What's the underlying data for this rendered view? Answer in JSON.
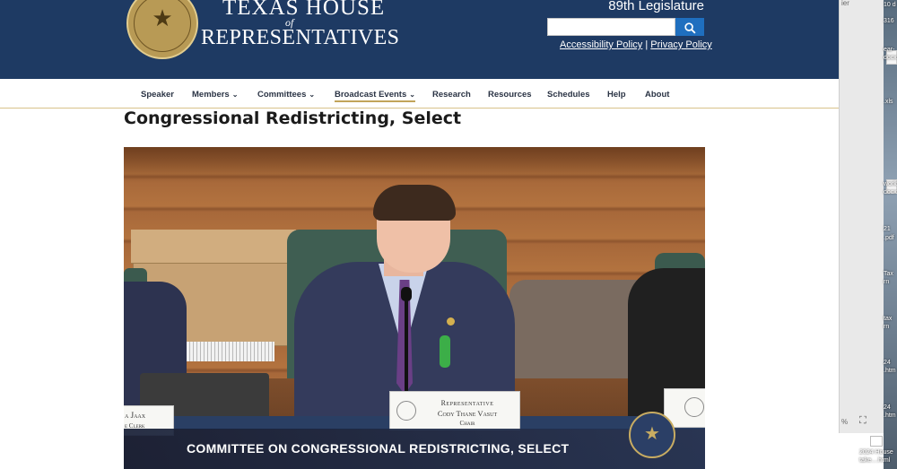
{
  "header": {
    "title_line1": "TEXAS HOUSE",
    "title_of": "of",
    "title_line2": "REPRESENTATIVES",
    "legislature": "89th Legislature",
    "search": {
      "placeholder": "",
      "value": ""
    },
    "accessibility_link": "Accessibility Policy",
    "separator": "|",
    "privacy_link": "Privacy Policy"
  },
  "nav": {
    "items": [
      {
        "label": "Speaker",
        "chevron": ""
      },
      {
        "label": "Members",
        "chevron": "⌄"
      },
      {
        "label": "Committees",
        "chevron": "⌄"
      },
      {
        "label": "Broadcast Events",
        "chevron": "⌄"
      },
      {
        "label": "Research",
        "chevron": ""
      },
      {
        "label": "Resources",
        "chevron": ""
      },
      {
        "label": "Schedules",
        "chevron": ""
      },
      {
        "label": "Help",
        "chevron": ""
      },
      {
        "label": "About",
        "chevron": ""
      }
    ],
    "active_item": "Broadcast Events"
  },
  "page": {
    "title": "Congressional Redistricting, Select"
  },
  "video": {
    "caption": "COMMITTEE ON CONGRESSIONAL REDISTRICTING, SELECT",
    "placard_chair": {
      "line1": "Representative",
      "line2": "Cody Thane Vasut",
      "line3": "Chair"
    },
    "placard_clerk": {
      "line1": "a Jaax",
      "line2": "e Clerk"
    }
  },
  "side_panel": {
    "fragment": "ier",
    "zoom": "%",
    "expand_icon": "⛶"
  },
  "desktop": {
    "labels": [
      "10 d",
      "316",
      "ear-",
      "docx",
      ".xls",
      "work",
      "docx",
      "21",
      ".pdf",
      "Tax",
      "rn",
      "tax",
      "rn",
      "24",
      ".htm",
      "24",
      ".htm"
    ],
    "bottom_file": {
      "line1": "2024 House",
      "line2": "take....html"
    }
  },
  "colors": {
    "masthead": "#1e3a63",
    "search_button": "#1f6fbf",
    "nav_text": "#2a3344",
    "accent_gold": "#c2a45a"
  }
}
